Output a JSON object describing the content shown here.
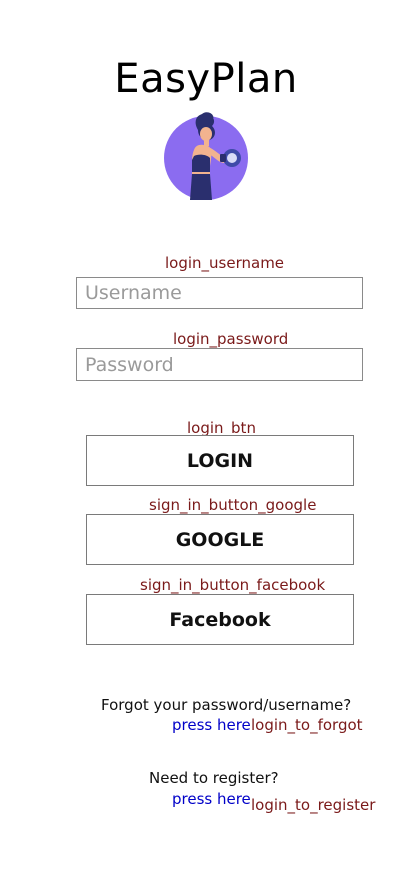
{
  "app": {
    "title": "EasyPlan",
    "logo_icon": "woman-lifting-dumbbell-icon"
  },
  "login": {
    "username_id": "login_username",
    "username_placeholder": "Username",
    "password_id": "login_password",
    "password_placeholder": "Password",
    "login_btn_id": "login_btn",
    "login_label": "LOGIN",
    "google_btn_id": "sign_in_button_google",
    "google_label": "GOOGLE",
    "facebook_btn_id": "sign_in_button_facebook",
    "facebook_label": "Facebook"
  },
  "forgot": {
    "prompt": "Forgot your password/username?",
    "link_label": "press here",
    "link_id": "login_to_forgot"
  },
  "register": {
    "prompt": "Need to register?",
    "link_label": "press here",
    "link_id": "login_to_register"
  },
  "colors": {
    "debug_label": "#7a1a1a",
    "link": "#0000c8",
    "logo_circle": "#8b6cf0"
  }
}
